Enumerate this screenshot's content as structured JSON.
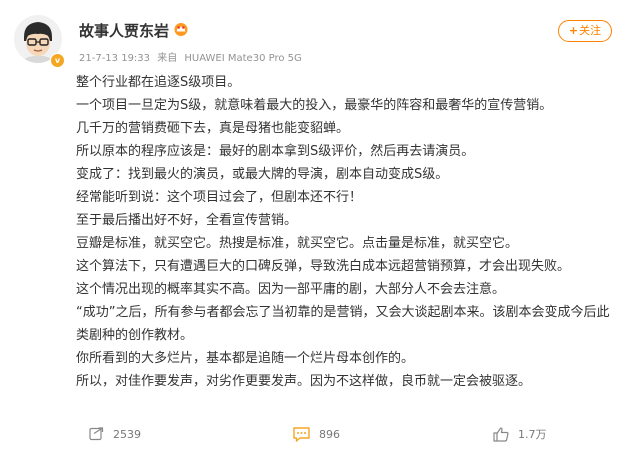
{
  "user": {
    "name": "故事人贾东岩",
    "badge_glyph": "v"
  },
  "post": {
    "date": "21-7-13 19:33",
    "source_prefix": "来自",
    "device": "HUAWEI Mate30 Pro 5G",
    "lines": [
      "整个行业都在追逐S级项目。",
      "一个项目一旦定为S级，就意味着最大的投入，最豪华的阵容和最奢华的宣传营销。",
      "几千万的营销费砸下去，真是母猪也能变貂蝉。",
      "所以原本的程序应该是：最好的剧本拿到S级评价，然后再去请演员。",
      "变成了：找到最火的演员，或最大牌的导演，剧本自动变成S级。",
      "经常能听到说：这个项目过会了，但剧本还不行！",
      "至于最后播出好不好，全看宣传营销。",
      "豆瓣是标准，就买空它。热搜是标准，就买空它。点击量是标准，就买空它。",
      "这个算法下，只有遭遇巨大的口碑反弹，导致洗白成本远超营销预算，才会出现失败。",
      "这个情况出现的概率其实不高。因为一部平庸的剧，大部分人不会去注意。",
      "“成功”之后，所有参与者都会忘了当初靠的是营销，又会大谈起剧本来。该剧本会变成今后此类剧种的创作教材。",
      "你所看到的大多烂片，基本都是追随一个烂片母本创作的。",
      "所以，对佳作要发声，对劣作更要发声。因为不这样做，良币就一定会被驱逐。"
    ]
  },
  "follow_button": {
    "plus": "+",
    "label": "关注"
  },
  "actions": {
    "repost_count": "2539",
    "comment_count": "896",
    "like_count": "1.7万"
  },
  "colors": {
    "accent": "#ff8200",
    "meta_text": "#939393",
    "body_text": "#333333",
    "badge": "#f5a623",
    "comment_icon": "#f5a623"
  },
  "icons": {
    "vip": "vip-crown-icon",
    "repost": "repost-icon",
    "comment": "comment-icon",
    "like": "thumb-up-icon"
  }
}
